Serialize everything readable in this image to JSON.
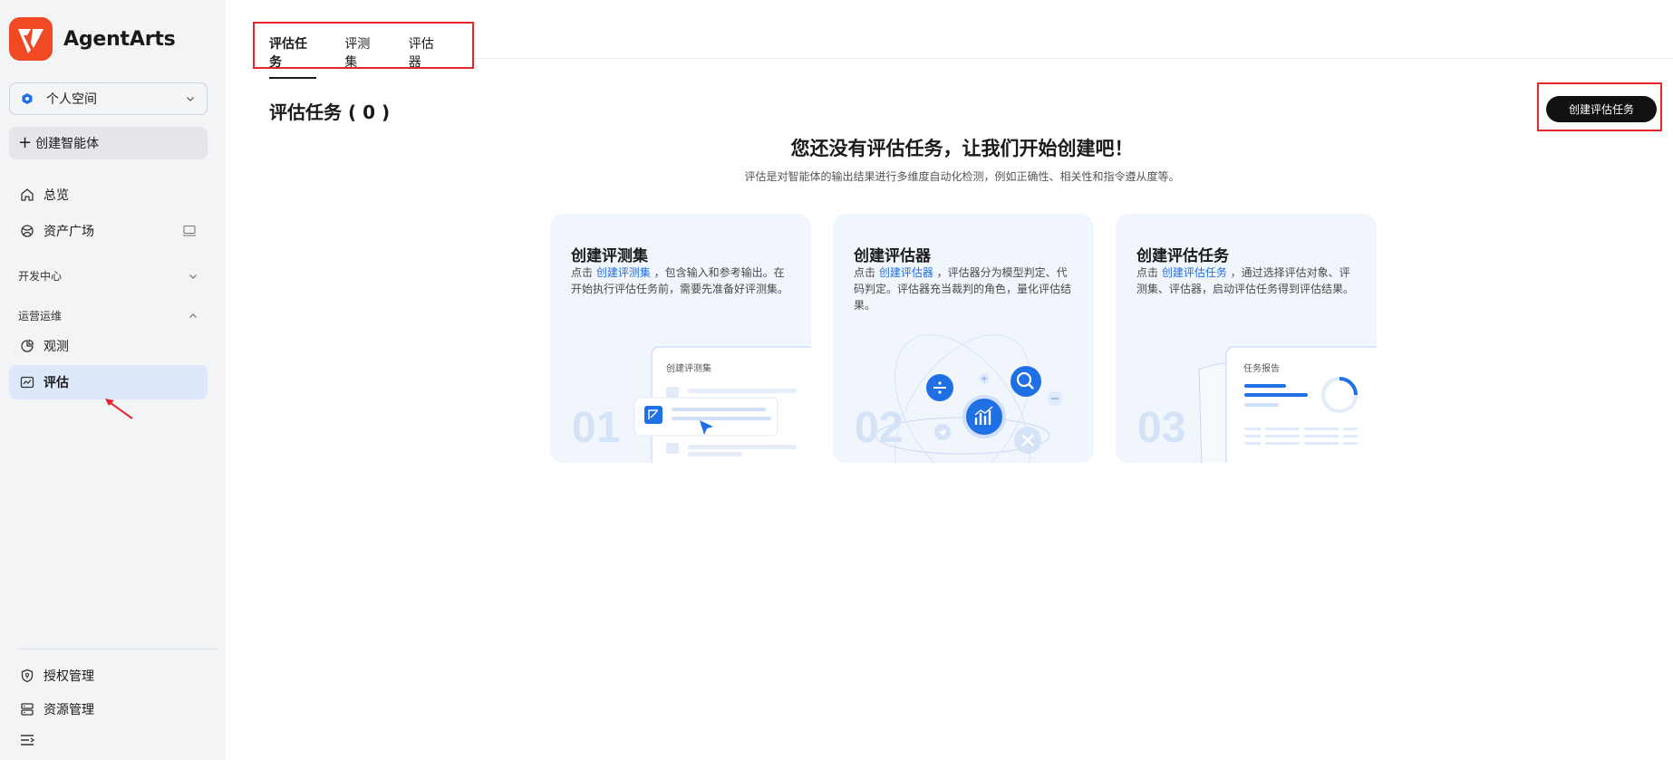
{
  "app": {
    "name": "AgentArts"
  },
  "sidebar": {
    "space_label": "个人空间",
    "create_agent_label": "创建智能体",
    "items": [
      {
        "label": "总览"
      },
      {
        "label": "资产广场"
      }
    ],
    "sections": [
      {
        "label": "开发中心"
      },
      {
        "label": "运营运维"
      }
    ],
    "ops_items": [
      {
        "label": "观测"
      },
      {
        "label": "评估"
      }
    ],
    "bottom_items": [
      {
        "label": "授权管理"
      },
      {
        "label": "资源管理"
      }
    ]
  },
  "tabs": [
    {
      "label": "评估任务",
      "active": true
    },
    {
      "label": "评测集"
    },
    {
      "label": "评估器"
    }
  ],
  "main": {
    "title": "评估任务 ( 0 )",
    "create_button": "创建评估任务",
    "empty_title": "您还没有评估任务，让我们开始创建吧！",
    "empty_subtitle": "评估是对智能体的输出结果进行多维度自动化检测，例如正确性、相关性和指令遵从度等。"
  },
  "cards": [
    {
      "title": "创建评测集",
      "desc_prefix": "点击 ",
      "link": "创建评测集",
      "desc_suffix": " ，包含输入和参考输出。在开始执行评估任务前，需要先准备好评测集。",
      "number": "01",
      "mock_label": "创建评测集"
    },
    {
      "title": "创建评估器",
      "desc_prefix": "点击 ",
      "link": "创建评估器",
      "desc_suffix": " ，评估器分为模型判定、代码判定。评估器充当裁判的角色，量化评估结果。",
      "number": "02"
    },
    {
      "title": "创建评估任务",
      "desc_prefix": "点击 ",
      "link": "创建评估任务",
      "desc_suffix": " ，通过选择评估对象、评测集、评估器，启动评估任务得到评估结果。",
      "number": "03",
      "mock_label": "任务报告"
    }
  ],
  "colors": {
    "accent": "#1f6fe5",
    "brand": "#f04a25",
    "active_nav_bg": "#dde9fb",
    "highlight_box": "#e5262a"
  }
}
